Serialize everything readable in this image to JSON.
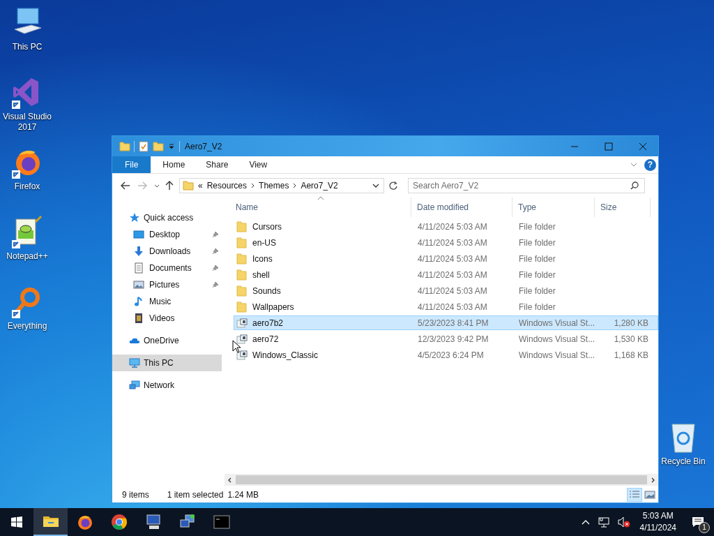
{
  "desktop_icons": [
    {
      "label": "This PC",
      "kind": "pc",
      "shortcut": false
    },
    {
      "label": "Visual Studio 2017",
      "kind": "vs",
      "shortcut": true
    },
    {
      "label": "Firefox",
      "kind": "firefox",
      "shortcut": true
    },
    {
      "label": "Notepad++",
      "kind": "notepad",
      "shortcut": true
    },
    {
      "label": "Everything",
      "kind": "everything",
      "shortcut": true
    }
  ],
  "recycle_bin": {
    "label": "Recycle Bin"
  },
  "window": {
    "title": "Aero7_V2",
    "ribbon_tabs": [
      {
        "label": "File",
        "kind": "file"
      },
      {
        "label": "Home",
        "kind": "tab"
      },
      {
        "label": "Share",
        "kind": "tab"
      },
      {
        "label": "View",
        "kind": "tab"
      }
    ],
    "help": "?",
    "address": {
      "overflow": "«",
      "crumbs": [
        "Resources",
        "Themes",
        "Aero7_V2"
      ]
    },
    "search": {
      "placeholder": "Search Aero7_V2"
    },
    "nav": [
      {
        "label": "Quick access",
        "kind": "star",
        "selected": false,
        "children": [
          {
            "label": "Desktop",
            "kind": "desktop",
            "pinned": true,
            "selected": false
          },
          {
            "label": "Downloads",
            "kind": "downloads",
            "pinned": true,
            "selected": false
          },
          {
            "label": "Documents",
            "kind": "documents",
            "pinned": true,
            "selected": false
          },
          {
            "label": "Pictures",
            "kind": "pictures",
            "pinned": true,
            "selected": false
          },
          {
            "label": "Music",
            "kind": "music",
            "pinned": false,
            "selected": false
          },
          {
            "label": "Videos",
            "kind": "videos",
            "pinned": false,
            "selected": false
          }
        ]
      },
      {
        "label": "OneDrive",
        "kind": "cloud",
        "selected": false
      },
      {
        "label": "This PC",
        "kind": "pc",
        "selected": true
      },
      {
        "label": "Network",
        "kind": "network",
        "selected": false
      }
    ],
    "columns": [
      {
        "label": "Name",
        "sorted": true
      },
      {
        "label": "Date modified",
        "sorted": false
      },
      {
        "label": "Type",
        "sorted": false
      },
      {
        "label": "Size",
        "sorted": false
      }
    ],
    "rows": [
      {
        "name": "Cursors",
        "date": "4/11/2024 5:03 AM",
        "type": "File folder",
        "kind": "folder",
        "selected": false
      },
      {
        "name": "en-US",
        "date": "4/11/2024 5:03 AM",
        "type": "File folder",
        "kind": "folder",
        "selected": false
      },
      {
        "name": "Icons",
        "date": "4/11/2024 5:03 AM",
        "type": "File folder",
        "kind": "folder",
        "selected": false
      },
      {
        "name": "shell",
        "date": "4/11/2024 5:03 AM",
        "type": "File folder",
        "kind": "folder",
        "selected": false
      },
      {
        "name": "Sounds",
        "date": "4/11/2024 5:03 AM",
        "type": "File folder",
        "kind": "folder",
        "selected": false
      },
      {
        "name": "Wallpapers",
        "date": "4/11/2024 5:03 AM",
        "type": "File folder",
        "kind": "folder",
        "selected": false
      },
      {
        "name": "aero7b2",
        "date": "5/23/2023 8:41 PM",
        "type": "Windows Visual St...",
        "size": "1,280 KB",
        "kind": "theme",
        "selected": true
      },
      {
        "name": "aero72",
        "date": "12/3/2023 9:42 PM",
        "type": "Windows Visual St...",
        "size": "1,530 KB",
        "kind": "theme",
        "selected": false
      },
      {
        "name": "Windows_Classic",
        "date": "4/5/2023 6:24 PM",
        "type": "Windows Visual St...",
        "size": "1,168 KB",
        "kind": "theme",
        "selected": false
      }
    ],
    "status": {
      "count": "9 items",
      "selection": "1 item selected",
      "size": "1.24 MB"
    },
    "view_buttons": [
      {
        "kind": "details",
        "selected": true
      },
      {
        "kind": "preview",
        "selected": false
      }
    ]
  },
  "taskbar": {
    "apps": [
      {
        "kind": "explorer",
        "active": true
      },
      {
        "kind": "firefox",
        "active": false
      },
      {
        "kind": "chrome",
        "active": false
      },
      {
        "kind": "monitor",
        "active": false
      },
      {
        "kind": "netpc",
        "active": false
      },
      {
        "kind": "terminal",
        "active": false
      }
    ],
    "time": "5:03 AM",
    "date": "4/11/2024",
    "notifications": "1"
  }
}
